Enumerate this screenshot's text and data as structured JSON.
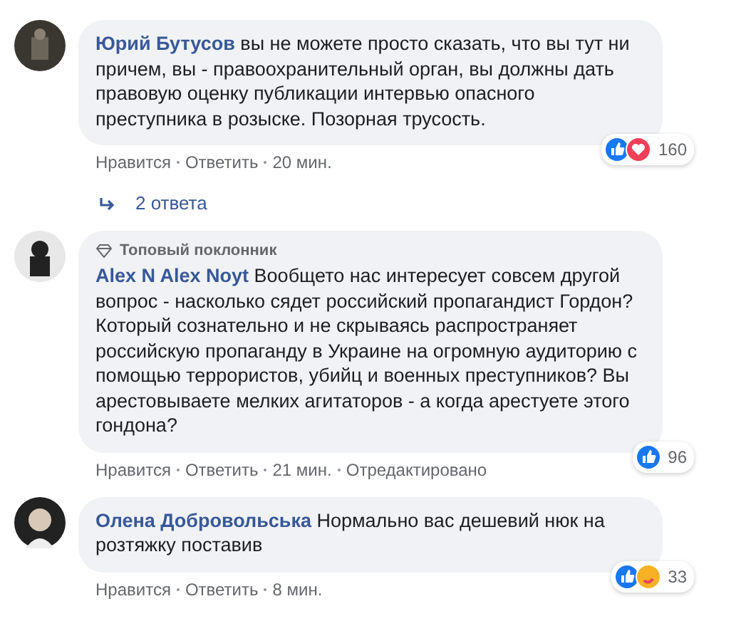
{
  "comments": [
    {
      "author": "Юрий Бутусов",
      "text": "вы не можете просто сказать, что вы тут ни причем, вы - правоохранительный орган, вы должны дать правовую оценку публикации интервью опасного преступника в розыске. Позорная трусость.",
      "reaction_count": "160",
      "actions": [
        "Нравится",
        "Ответить",
        "20 мин."
      ],
      "replies": "2 ответа"
    },
    {
      "author": "Alex N Alex Noyt",
      "badge": "Топовый поклонник",
      "text": "Вообщето нас интересует совсем другой вопрос - насколько сядет российский пропагандист Гордон? Который сознательно и не скрываясь распространяет российскую пропаганду в Украине на огромную аудиторию с помощью террористов, убийц и военных преступников? Вы арестовываете мелких агитаторов - а когда арестуете этого гондона?",
      "reaction_count": "96",
      "actions": [
        "Нравится",
        "Ответить",
        "21 мин.",
        "Отредактировано"
      ]
    },
    {
      "author": "Олена Добровольська",
      "text": "Нормально вас дешевий нюк на розтяжку поставив",
      "reaction_count": "33",
      "actions": [
        "Нравится",
        "Ответить",
        "8 мин."
      ]
    }
  ]
}
